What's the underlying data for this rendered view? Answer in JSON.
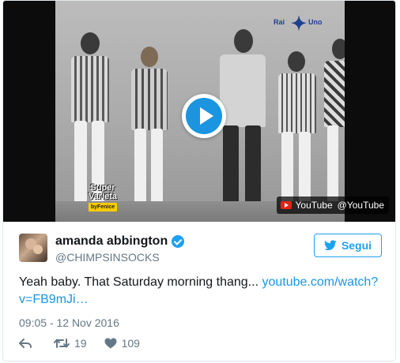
{
  "video": {
    "channel_logo": {
      "line1": "Rai",
      "line2": "Uno",
      "icon": "star-icon"
    },
    "show_logo": {
      "line1": "Super",
      "line2": "Varietà",
      "by": "byFenice"
    },
    "play_icon": "play-icon",
    "attribution": {
      "source": "YouTube",
      "handle": "@YouTube",
      "icon": "youtube-icon"
    }
  },
  "author": {
    "name": "amanda abbington",
    "handle": "@CHIMPSINSOCKS",
    "verified": true
  },
  "follow_button": {
    "label": "Segui",
    "icon": "twitter-bird-icon"
  },
  "tweet": {
    "text": "Yeah baby. That Saturday morning thang... ",
    "link": "youtube.com/watch?v=FB9mJi…"
  },
  "timestamp": "09:05 - 12 Nov 2016",
  "actions": {
    "retweets": "19",
    "likes": "109"
  },
  "colors": {
    "accent": "#1da1f2",
    "link": "#1b95e0",
    "muted": "#657786",
    "play": "#1b95e0",
    "youtube": "#e62117"
  }
}
